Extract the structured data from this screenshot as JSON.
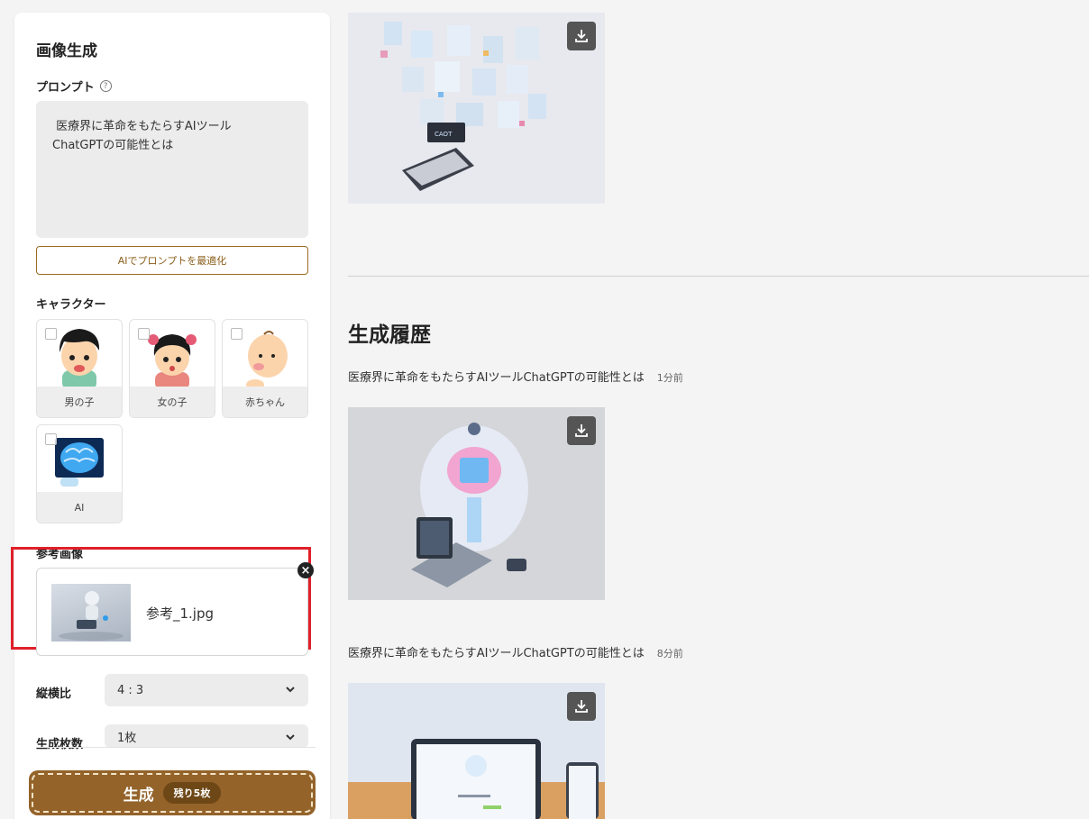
{
  "sidebar": {
    "title": "画像生成",
    "prompt_label": "プロンプト",
    "prompt_value": " 医療界に革命をもたらすAIツール\nChatGPTの可能性とは",
    "optimize_button": "AIでプロンプトを最適化",
    "character_label": "キャラクター",
    "characters": [
      {
        "name": "男の子",
        "checked": false
      },
      {
        "name": "女の子",
        "checked": false
      },
      {
        "name": "赤ちゃん",
        "checked": false
      },
      {
        "name": "AI",
        "checked": false
      }
    ],
    "reference_label": "参考画像",
    "reference_file": "参考_1.jpg",
    "aspect_label": "縦横比",
    "aspect_value": "4 : 3",
    "count_label": "生成枚数",
    "count_value": "1枚",
    "generate_label": "生成",
    "remaining_badge": "残り5枚"
  },
  "main": {
    "history_title": "生成履歴",
    "history": [
      {
        "prompt": "医療界に革命をもたらすAIツールChatGPTの可能性とは",
        "time": "1分前"
      },
      {
        "prompt": "医療界に革命をもたらすAIツールChatGPTの可能性とは",
        "time": "8分前"
      }
    ]
  },
  "colors": {
    "accent_brown": "#94632a",
    "highlight_red": "#e0202a",
    "panel_bg": "#ffffff",
    "page_bg": "#f4f4f4"
  }
}
